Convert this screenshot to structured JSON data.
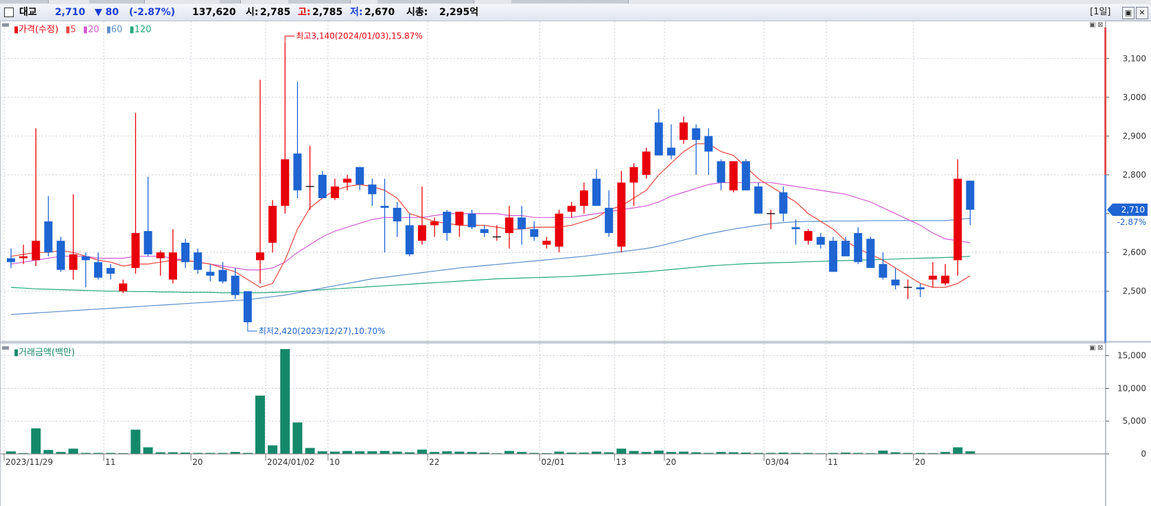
{
  "header": {
    "name": "대교",
    "price": "2,710",
    "change": "▼ 80",
    "change_pct": "(-2.87%)",
    "volume": "137,620",
    "open_label": "시:",
    "open": "2,785",
    "high_label": "고:",
    "high": "2,785",
    "low_label": "저:",
    "low": "2,670",
    "mcap_label": "시총:",
    "mcap": "2,295억",
    "period": "[1일]"
  },
  "price_panel": {
    "legend": {
      "title": "가격(수정)",
      "ma": [
        "5",
        "20",
        "60",
        "120"
      ]
    },
    "max_annotation": "최고3,140(2024/01/03),15.87%",
    "min_annotation": "최저2,420(2023/12/27),10.70%",
    "last_price_tag": "2,710",
    "last_change_tag": "-2.87%",
    "y_ticks": [
      "3,100",
      "3,000",
      "2,900",
      "2,800",
      "2,700",
      "2,600",
      "2,500"
    ]
  },
  "volume_panel": {
    "legend": "거래금액(백만)",
    "y_ticks": [
      "15,000",
      "10,000",
      "5,000",
      "0"
    ]
  },
  "x_labels": [
    "2023/11/29",
    "11",
    "20",
    "2024/01/02",
    "10",
    "22",
    "02/01",
    "13",
    "20",
    "03/04",
    "11",
    "20"
  ],
  "colors": {
    "up": "#e8000b",
    "down": "#1e64d2",
    "ma5": "#e8453c",
    "ma20": "#d35ad3",
    "ma60": "#5d8fc9",
    "ma120": "#22a87a",
    "volume": "#14896a"
  },
  "chart_data": {
    "type": "candlestick",
    "y_range": [
      2420,
      3180
    ],
    "volume_range": [
      0,
      18000
    ],
    "candles": [
      [
        2585,
        2610,
        2560,
        2575
      ],
      [
        2585,
        2620,
        2570,
        2590
      ],
      [
        2580,
        2920,
        2565,
        2630
      ],
      [
        2680,
        2745,
        2590,
        2600
      ],
      [
        2630,
        2640,
        2550,
        2555
      ],
      [
        2555,
        2750,
        2530,
        2595
      ],
      [
        2590,
        2600,
        2510,
        2580
      ],
      [
        2575,
        2600,
        2530,
        2535
      ],
      [
        2560,
        2570,
        2530,
        2545
      ],
      [
        2500,
        2530,
        2495,
        2520
      ],
      [
        2560,
        2960,
        2545,
        2650
      ],
      [
        2655,
        2795,
        2590,
        2595
      ],
      [
        2585,
        2605,
        2540,
        2600
      ],
      [
        2530,
        2660,
        2520,
        2600
      ],
      [
        2625,
        2635,
        2560,
        2575
      ],
      [
        2600,
        2610,
        2545,
        2555
      ],
      [
        2550,
        2570,
        2525,
        2540
      ],
      [
        2555,
        2575,
        2520,
        2525
      ],
      [
        2540,
        2560,
        2480,
        2490
      ],
      [
        2500,
        2500,
        2415,
        2420
      ],
      [
        2580,
        3045,
        2520,
        2600
      ],
      [
        2625,
        2735,
        2600,
        2720
      ],
      [
        2720,
        3140,
        2700,
        2840
      ],
      [
        2855,
        3040,
        2740,
        2760
      ],
      [
        2770,
        2875,
        2710,
        2770
      ],
      [
        2800,
        2810,
        2740,
        2740
      ],
      [
        2740,
        2790,
        2735,
        2770
      ],
      [
        2780,
        2800,
        2760,
        2790
      ],
      [
        2820,
        2820,
        2760,
        2775
      ],
      [
        2775,
        2790,
        2720,
        2750
      ],
      [
        2720,
        2790,
        2600,
        2715
      ],
      [
        2715,
        2730,
        2640,
        2680
      ],
      [
        2670,
        2700,
        2590,
        2595
      ],
      [
        2630,
        2770,
        2620,
        2670
      ],
      [
        2670,
        2690,
        2640,
        2680
      ],
      [
        2705,
        2710,
        2630,
        2650
      ],
      [
        2670,
        2700,
        2640,
        2705
      ],
      [
        2700,
        2710,
        2660,
        2665
      ],
      [
        2660,
        2670,
        2640,
        2650
      ],
      [
        2640,
        2670,
        2630,
        2640
      ],
      [
        2650,
        2720,
        2610,
        2690
      ],
      [
        2690,
        2720,
        2620,
        2660
      ],
      [
        2660,
        2680,
        2630,
        2640
      ],
      [
        2620,
        2640,
        2610,
        2630
      ],
      [
        2615,
        2710,
        2600,
        2700
      ],
      [
        2705,
        2730,
        2690,
        2720
      ],
      [
        2720,
        2780,
        2700,
        2760
      ],
      [
        2790,
        2815,
        2720,
        2720
      ],
      [
        2715,
        2760,
        2640,
        2650
      ],
      [
        2615,
        2810,
        2600,
        2780
      ],
      [
        2780,
        2830,
        2720,
        2820
      ],
      [
        2800,
        2870,
        2790,
        2860
      ],
      [
        2935,
        2970,
        2860,
        2850
      ],
      [
        2870,
        2930,
        2840,
        2850
      ],
      [
        2890,
        2950,
        2880,
        2935
      ],
      [
        2920,
        2930,
        2800,
        2890
      ],
      [
        2900,
        2920,
        2800,
        2860
      ],
      [
        2835,
        2840,
        2760,
        2780
      ],
      [
        2760,
        2835,
        2755,
        2835
      ],
      [
        2835,
        2840,
        2760,
        2760
      ],
      [
        2770,
        2780,
        2700,
        2700
      ],
      [
        2700,
        2710,
        2660,
        2700
      ],
      [
        2755,
        2770,
        2680,
        2700
      ],
      [
        2665,
        2685,
        2620,
        2660
      ],
      [
        2630,
        2660,
        2620,
        2655
      ],
      [
        2640,
        2650,
        2610,
        2620
      ],
      [
        2630,
        2640,
        2550,
        2550
      ],
      [
        2630,
        2640,
        2590,
        2590
      ],
      [
        2650,
        2665,
        2570,
        2575
      ],
      [
        2635,
        2640,
        2560,
        2560
      ],
      [
        2570,
        2600,
        2530,
        2535
      ],
      [
        2530,
        2560,
        2505,
        2515
      ],
      [
        2510,
        2530,
        2480,
        2510
      ],
      [
        2510,
        2520,
        2485,
        2505
      ],
      [
        2530,
        2575,
        2510,
        2540
      ],
      [
        2520,
        2570,
        2515,
        2540
      ],
      [
        2580,
        2840,
        2540,
        2790
      ],
      [
        2785,
        2785,
        2670,
        2710
      ]
    ],
    "ma5": [
      2590,
      2595,
      2600,
      2600,
      2605,
      2600,
      2590,
      2580,
      2575,
      2565,
      2570,
      2570,
      2575,
      2580,
      2580,
      2575,
      2570,
      2560,
      2550,
      2530,
      2510,
      2520,
      2580,
      2660,
      2715,
      2740,
      2760,
      2770,
      2775,
      2770,
      2760,
      2740,
      2700,
      2690,
      2680,
      2675,
      2670,
      2670,
      2670,
      2665,
      2660,
      2660,
      2665,
      2665,
      2665,
      2670,
      2680,
      2690,
      2710,
      2720,
      2740,
      2760,
      2800,
      2830,
      2860,
      2880,
      2880,
      2860,
      2850,
      2820,
      2790,
      2770,
      2750,
      2730,
      2700,
      2680,
      2660,
      2630,
      2610,
      2595,
      2580,
      2560,
      2540,
      2520,
      2510,
      2510,
      2520,
      2540
    ],
    "ma20": [
      2570,
      2575,
      2580,
      2585,
      2590,
      2590,
      2590,
      2585,
      2585,
      2585,
      2590,
      2590,
      2590,
      2585,
      2580,
      2575,
      2570,
      2565,
      2560,
      2555,
      2555,
      2560,
      2575,
      2600,
      2620,
      2640,
      2655,
      2665,
      2675,
      2685,
      2690,
      2690,
      2690,
      2690,
      2695,
      2700,
      2700,
      2700,
      2700,
      2700,
      2695,
      2695,
      2690,
      2690,
      2690,
      2690,
      2695,
      2700,
      2705,
      2710,
      2715,
      2720,
      2730,
      2745,
      2755,
      2765,
      2775,
      2780,
      2780,
      2780,
      2780,
      2780,
      2775,
      2770,
      2765,
      2760,
      2755,
      2750,
      2740,
      2730,
      2715,
      2700,
      2685,
      2670,
      2650,
      2635,
      2630,
      2625
    ],
    "ma60": [
      2440,
      2442,
      2444,
      2446,
      2448,
      2450,
      2452,
      2454,
      2456,
      2458,
      2460,
      2462,
      2464,
      2466,
      2468,
      2470,
      2472,
      2474,
      2476,
      2478,
      2482,
      2486,
      2490,
      2496,
      2502,
      2508,
      2514,
      2520,
      2526,
      2532,
      2536,
      2540,
      2544,
      2548,
      2552,
      2556,
      2560,
      2563,
      2566,
      2569,
      2572,
      2575,
      2578,
      2581,
      2584,
      2587,
      2590,
      2594,
      2598,
      2602,
      2606,
      2610,
      2616,
      2624,
      2632,
      2640,
      2648,
      2654,
      2660,
      2665,
      2670,
      2674,
      2677,
      2679,
      2680,
      2680,
      2681,
      2681,
      2681,
      2682,
      2682,
      2682,
      2682,
      2682,
      2682,
      2682,
      2685,
      2688
    ],
    "ma120": [
      2510,
      2508,
      2506,
      2505,
      2504,
      2503,
      2502,
      2501,
      2500,
      2500,
      2499,
      2499,
      2498,
      2498,
      2497,
      2497,
      2497,
      2496,
      2496,
      2496,
      2496,
      2497,
      2498,
      2500,
      2502,
      2504,
      2506,
      2508,
      2510,
      2512,
      2514,
      2516,
      2518,
      2520,
      2522,
      2524,
      2526,
      2528,
      2530,
      2532,
      2533,
      2534,
      2535,
      2536,
      2537,
      2538,
      2540,
      2542,
      2544,
      2546,
      2548,
      2550,
      2553,
      2556,
      2559,
      2562,
      2565,
      2567,
      2569,
      2571,
      2572,
      2573,
      2574,
      2575,
      2576,
      2577,
      2578,
      2579,
      2580,
      2581,
      2582,
      2583,
      2584,
      2585,
      2586,
      2587,
      2588,
      2590
    ],
    "volume": [
      380,
      120,
      3900,
      600,
      300,
      800,
      150,
      150,
      150,
      120,
      3700,
      1000,
      250,
      250,
      200,
      150,
      150,
      150,
      300,
      150,
      8900,
      1300,
      16000,
      4800,
      900,
      400,
      350,
      450,
      400,
      400,
      450,
      350,
      250,
      650,
      300,
      400,
      350,
      300,
      200,
      100,
      450,
      300,
      150,
      120,
      350,
      200,
      200,
      350,
      250,
      800,
      450,
      300,
      500,
      300,
      350,
      250,
      150,
      300,
      250,
      200,
      150,
      150,
      200,
      150,
      150,
      100,
      150,
      200,
      150,
      120,
      500,
      250,
      150,
      150,
      120,
      300,
      1000,
      400
    ]
  }
}
